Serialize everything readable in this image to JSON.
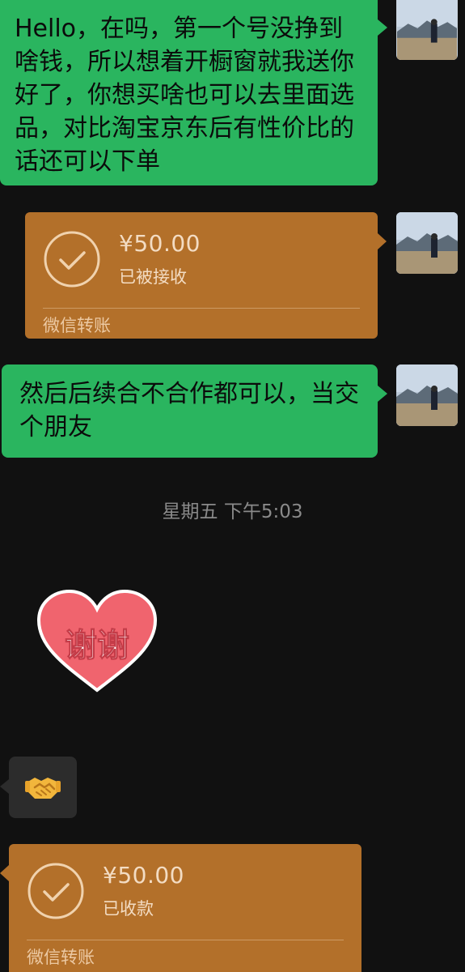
{
  "messages": {
    "msg1": {
      "text": "Hello，在吗，第一个号没挣到啥钱，所以想着开橱窗就我送你好了，你想买啥也可以去里面选品，对比淘宝京东后有性价比的话还可以下单"
    },
    "transfer1": {
      "amount": "¥50.00",
      "status": "已被接收",
      "footer": "微信转账"
    },
    "msg2": {
      "text": "然后后续合不合作都可以，当交个朋友"
    },
    "timestamp": "星期五 下午5:03",
    "sticker": {
      "text": "谢谢"
    },
    "emoji": {
      "icon": "handshake-icon"
    },
    "transfer2": {
      "amount": "¥50.00",
      "status": "已收款",
      "footer": "微信转账"
    }
  },
  "colors": {
    "background": "#111111",
    "green_bubble": "#2ab55f",
    "transfer_card": "#b3702a",
    "timestamp_text": "#8a8a8a",
    "sticker_heart": "#f0646e"
  }
}
